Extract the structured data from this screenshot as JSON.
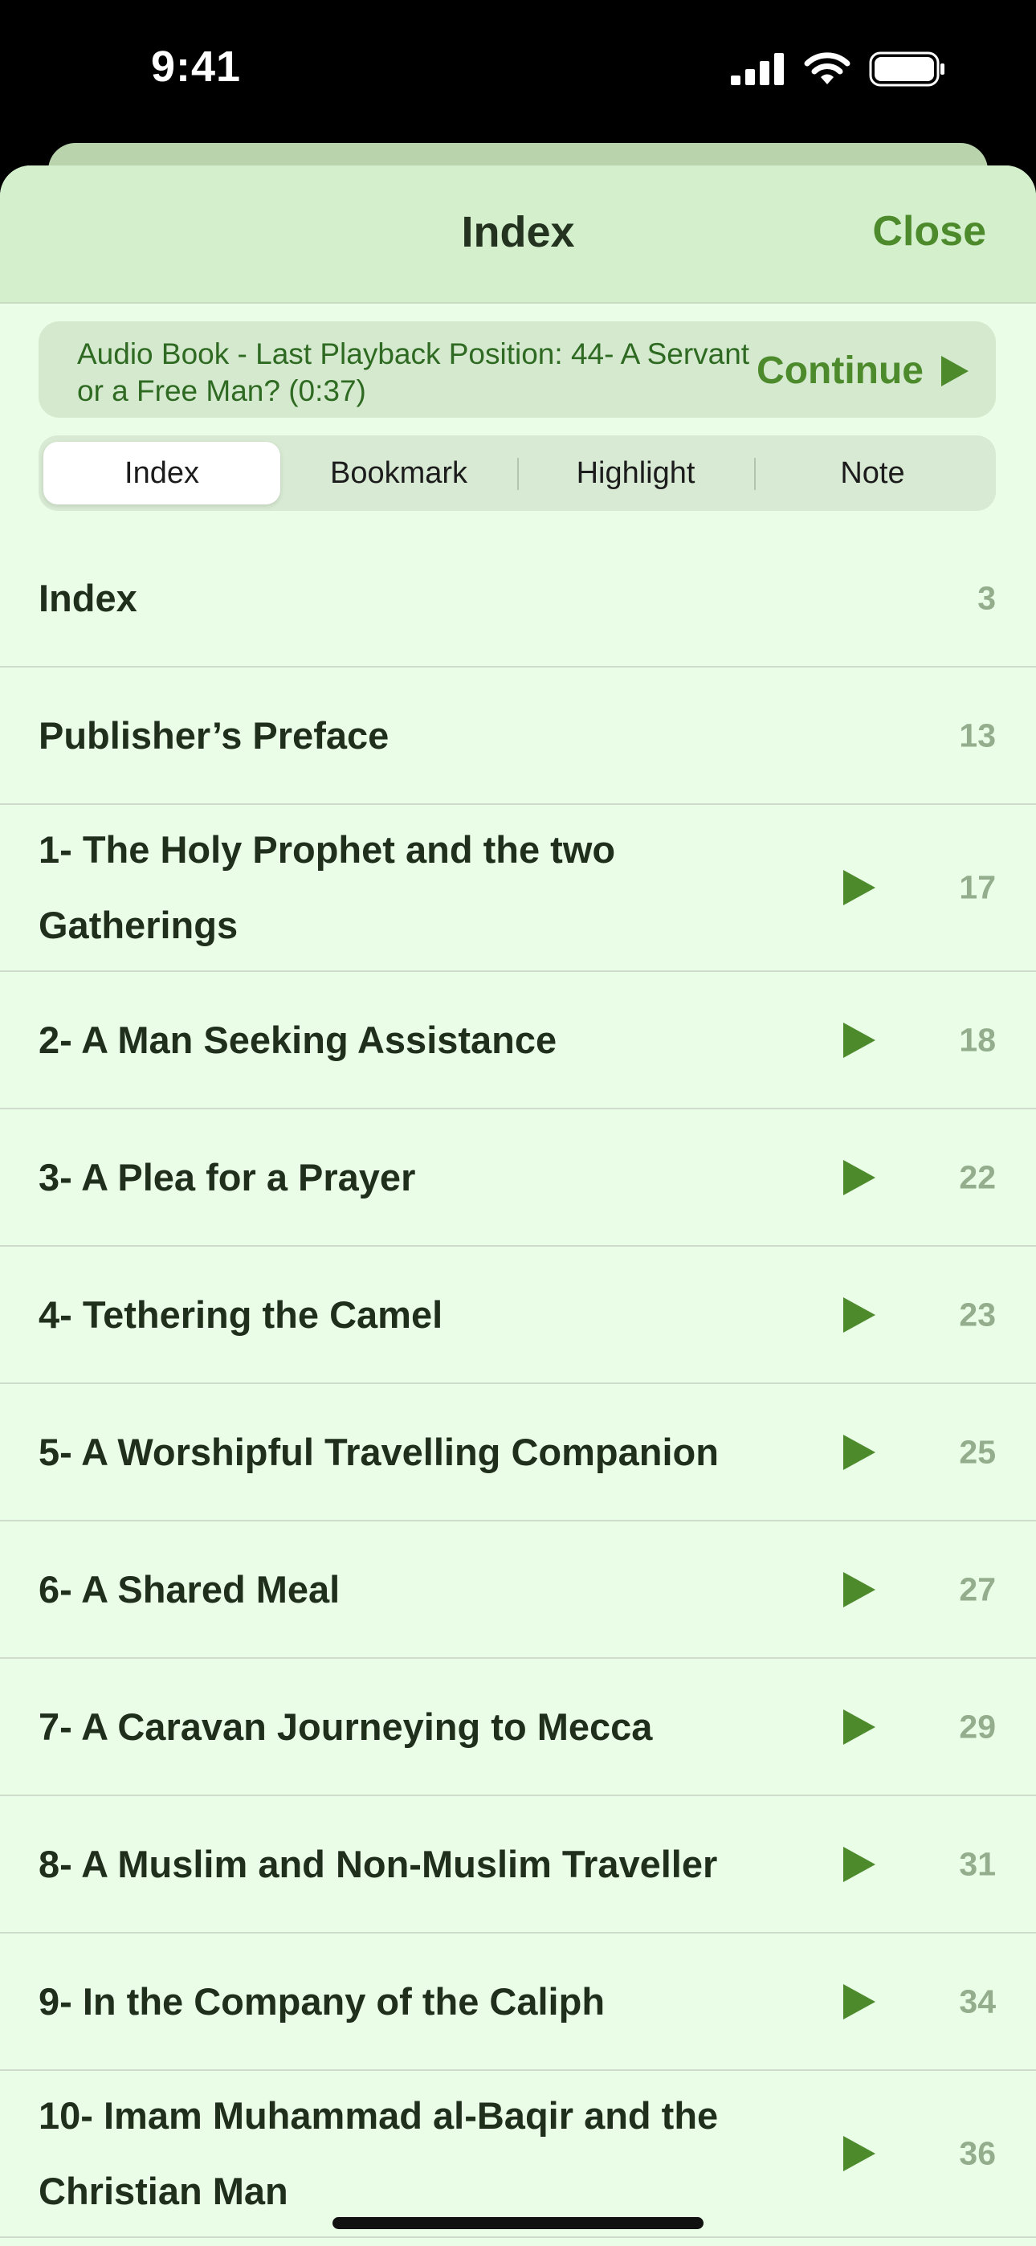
{
  "status": {
    "time": "9:41"
  },
  "header": {
    "title": "Index",
    "close_label": "Close"
  },
  "audio": {
    "text": "Audio Book - Last Playback Position: 44- A Servant or a Free Man? (0:37)",
    "continue_label": "Continue"
  },
  "tabs": [
    "Index",
    "Bookmark",
    "Highlight",
    "Note"
  ],
  "active_tab": "Index",
  "items": [
    {
      "title": "Index",
      "page": "3",
      "playable": false
    },
    {
      "title": "Publisher’s Preface",
      "page": "13",
      "playable": false
    },
    {
      "title": "1- The Holy Prophet and the two Gatherings",
      "page": "17",
      "playable": true
    },
    {
      "title": "2- A Man Seeking Assistance",
      "page": "18",
      "playable": true
    },
    {
      "title": "3- A Plea for a Prayer",
      "page": "22",
      "playable": true
    },
    {
      "title": "4- Tethering the Camel",
      "page": "23",
      "playable": true
    },
    {
      "title": "5- A Worshipful Travelling Companion",
      "page": "25",
      "playable": true
    },
    {
      "title": "6- A Shared Meal",
      "page": "27",
      "playable": true
    },
    {
      "title": "7- A Caravan Journeying to Mecca",
      "page": "29",
      "playable": true
    },
    {
      "title": "8- A Muslim and Non-Muslim Traveller",
      "page": "31",
      "playable": true
    },
    {
      "title": "9- In the Company of the Caliph",
      "page": "34",
      "playable": true
    },
    {
      "title": "10- Imam Muhammad al-Baqir and the Christian Man",
      "page": "36",
      "playable": true
    }
  ],
  "colors": {
    "accent": "#4c8a2c",
    "sheet": "#eafde6",
    "header": "#d3efcb"
  }
}
